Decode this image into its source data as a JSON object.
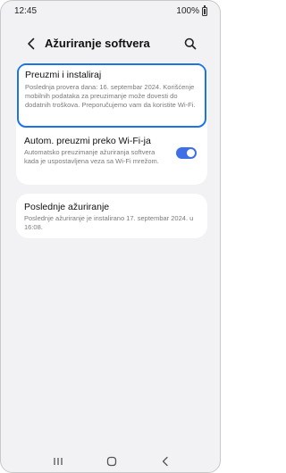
{
  "status_bar": {
    "time": "12:45",
    "battery_text": "100%"
  },
  "app_bar": {
    "title": "Ažuriranje softvera",
    "back_icon": "back-arrow-icon",
    "search_icon": "search-icon"
  },
  "settings": {
    "download_install": {
      "title": "Preuzmi i instaliraj",
      "description": "Poslednja provera dana: 16. septembar 2024. Korišćenje mobilnih podataka za preuzimanje može dovesti do dodatnih troškova. Preporučujemo vam da koristite Wi-Fi."
    },
    "auto_download_wifi": {
      "title": "Autom. preuzmi preko Wi-Fi-ja",
      "description": "Automatsko preuzimanje ažuriranja softvera kada je uspostavljena veza sa Wi-Fi mrežom.",
      "enabled": true
    },
    "last_update": {
      "title": "Poslednje ažuriranje",
      "description": "Poslednje ažuriranje je instalirano 17. septembar 2024. u 16:08."
    }
  },
  "nav_bar": {
    "recents_icon": "recents-icon",
    "home_icon": "home-icon",
    "back_icon": "nav-back-icon"
  },
  "colors": {
    "accent": "#3e6fe6",
    "highlight_border": "#1a73e8",
    "background": "#f2f2f4"
  }
}
